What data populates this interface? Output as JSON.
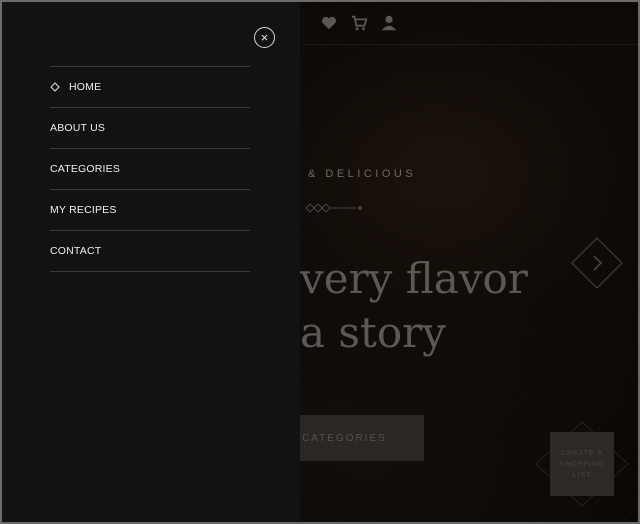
{
  "header": {
    "icons": [
      "heart-icon",
      "cart-icon",
      "user-icon"
    ]
  },
  "hero": {
    "tagline": "& DELICIOUS",
    "headline_line1": "very flavor",
    "headline_line2": "a story",
    "categories_button": "CATEGORIES",
    "shopping_button": "CREATE A SHOPPING LIST"
  },
  "drawer": {
    "close_label": "×",
    "items": [
      {
        "label": "HOME",
        "active": true
      },
      {
        "label": "ABOUT US"
      },
      {
        "label": "CATEGORIES"
      },
      {
        "label": "MY RECIPES"
      },
      {
        "label": "CONTACT"
      }
    ]
  },
  "colors": {
    "drawer_bg": "#121212",
    "menu_text": "#f0f0f0",
    "divider": "#3a3a3a"
  }
}
